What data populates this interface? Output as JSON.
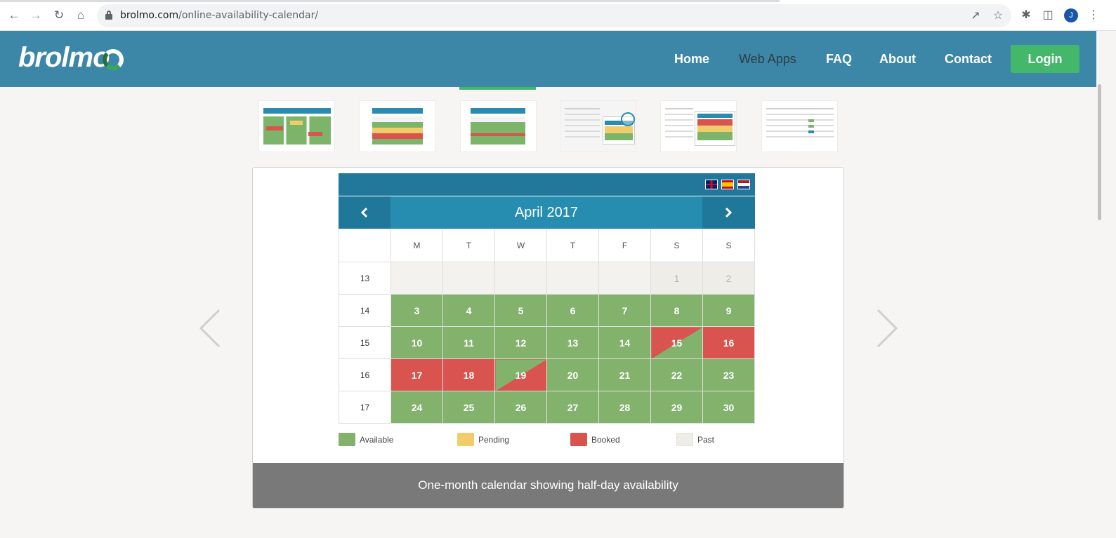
{
  "browser": {
    "url_host": "brolmo.com",
    "url_path": "/online-availability-calendar/",
    "avatar_letter": "J",
    "icons": [
      "back-icon",
      "forward-icon",
      "reload-icon",
      "home-icon",
      "share-icon",
      "star-icon",
      "extensions-icon",
      "side-panel-icon",
      "menu-icon"
    ]
  },
  "header": {
    "logo": "brolmo",
    "nav": [
      {
        "label": "Home",
        "active": false
      },
      {
        "label": "Web Apps",
        "active": true
      },
      {
        "label": "FAQ",
        "active": false
      },
      {
        "label": "About",
        "active": false
      },
      {
        "label": "Contact",
        "active": false
      }
    ],
    "login_label": "Login"
  },
  "calendar": {
    "month_title": "April 2017",
    "day_headers": [
      "M",
      "T",
      "W",
      "T",
      "F",
      "S",
      "S"
    ],
    "weeks": [
      {
        "week": "13",
        "days": [
          {
            "d": "",
            "s": "past"
          },
          {
            "d": "",
            "s": "past"
          },
          {
            "d": "",
            "s": "past"
          },
          {
            "d": "",
            "s": "past"
          },
          {
            "d": "",
            "s": "past"
          },
          {
            "d": "1",
            "s": "past-weekend"
          },
          {
            "d": "2",
            "s": "past-weekend"
          }
        ]
      },
      {
        "week": "14",
        "days": [
          {
            "d": "3",
            "s": "available"
          },
          {
            "d": "4",
            "s": "available"
          },
          {
            "d": "5",
            "s": "available"
          },
          {
            "d": "6",
            "s": "available"
          },
          {
            "d": "7",
            "s": "available"
          },
          {
            "d": "8",
            "s": "available"
          },
          {
            "d": "9",
            "s": "available"
          }
        ]
      },
      {
        "week": "15",
        "days": [
          {
            "d": "10",
            "s": "available"
          },
          {
            "d": "11",
            "s": "available"
          },
          {
            "d": "12",
            "s": "available"
          },
          {
            "d": "13",
            "s": "available"
          },
          {
            "d": "14",
            "s": "available"
          },
          {
            "d": "15",
            "s": "pm-booked"
          },
          {
            "d": "16",
            "s": "booked"
          }
        ]
      },
      {
        "week": "16",
        "days": [
          {
            "d": "17",
            "s": "booked"
          },
          {
            "d": "18",
            "s": "booked"
          },
          {
            "d": "19",
            "s": "am-booked"
          },
          {
            "d": "20",
            "s": "available"
          },
          {
            "d": "21",
            "s": "available"
          },
          {
            "d": "22",
            "s": "available"
          },
          {
            "d": "23",
            "s": "available"
          }
        ]
      },
      {
        "week": "17",
        "days": [
          {
            "d": "24",
            "s": "available"
          },
          {
            "d": "25",
            "s": "available"
          },
          {
            "d": "26",
            "s": "available"
          },
          {
            "d": "27",
            "s": "available"
          },
          {
            "d": "28",
            "s": "available"
          },
          {
            "d": "29",
            "s": "available"
          },
          {
            "d": "30",
            "s": "available"
          }
        ]
      }
    ],
    "legend": [
      {
        "label": "Available",
        "color": "#82b26c"
      },
      {
        "label": "Pending",
        "color": "#f1cc6b"
      },
      {
        "label": "Booked",
        "color": "#d9534f"
      },
      {
        "label": "Past",
        "color": "#efede8"
      }
    ],
    "flags": [
      "uk-flag-icon",
      "spain-flag-icon",
      "netherlands-flag-icon"
    ]
  },
  "slide": {
    "caption": "One-month calendar showing half-day availability",
    "thumbnail_count": 6,
    "active_thumbnail": 3
  }
}
